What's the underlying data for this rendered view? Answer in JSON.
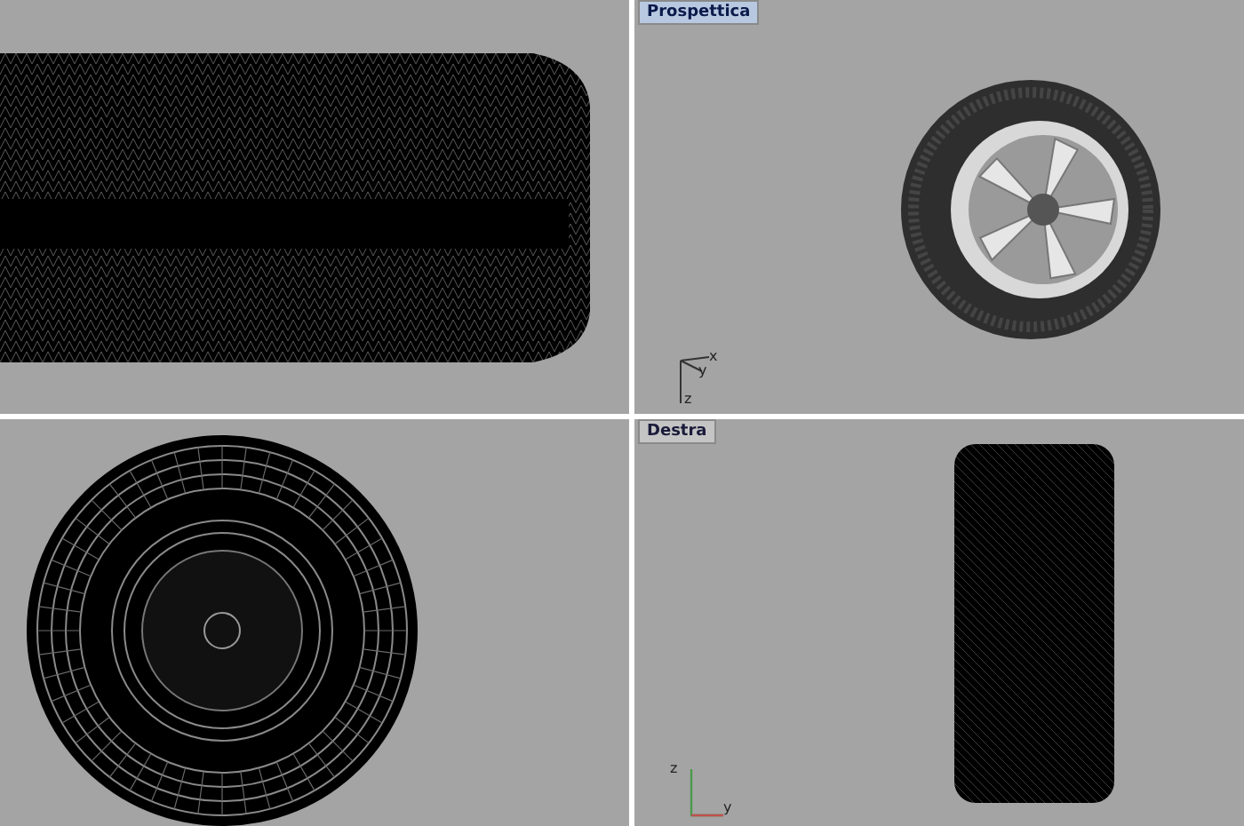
{
  "viewports": [
    {
      "kind": "side"
    },
    {
      "kind": "shaded",
      "title": "Prospettica",
      "selected": true,
      "axes": [
        "x",
        "y",
        "z"
      ]
    },
    {
      "kind": "front"
    },
    {
      "kind": "tread",
      "title": "Destra",
      "selected": false,
      "axes": [
        "z",
        "y"
      ]
    }
  ]
}
